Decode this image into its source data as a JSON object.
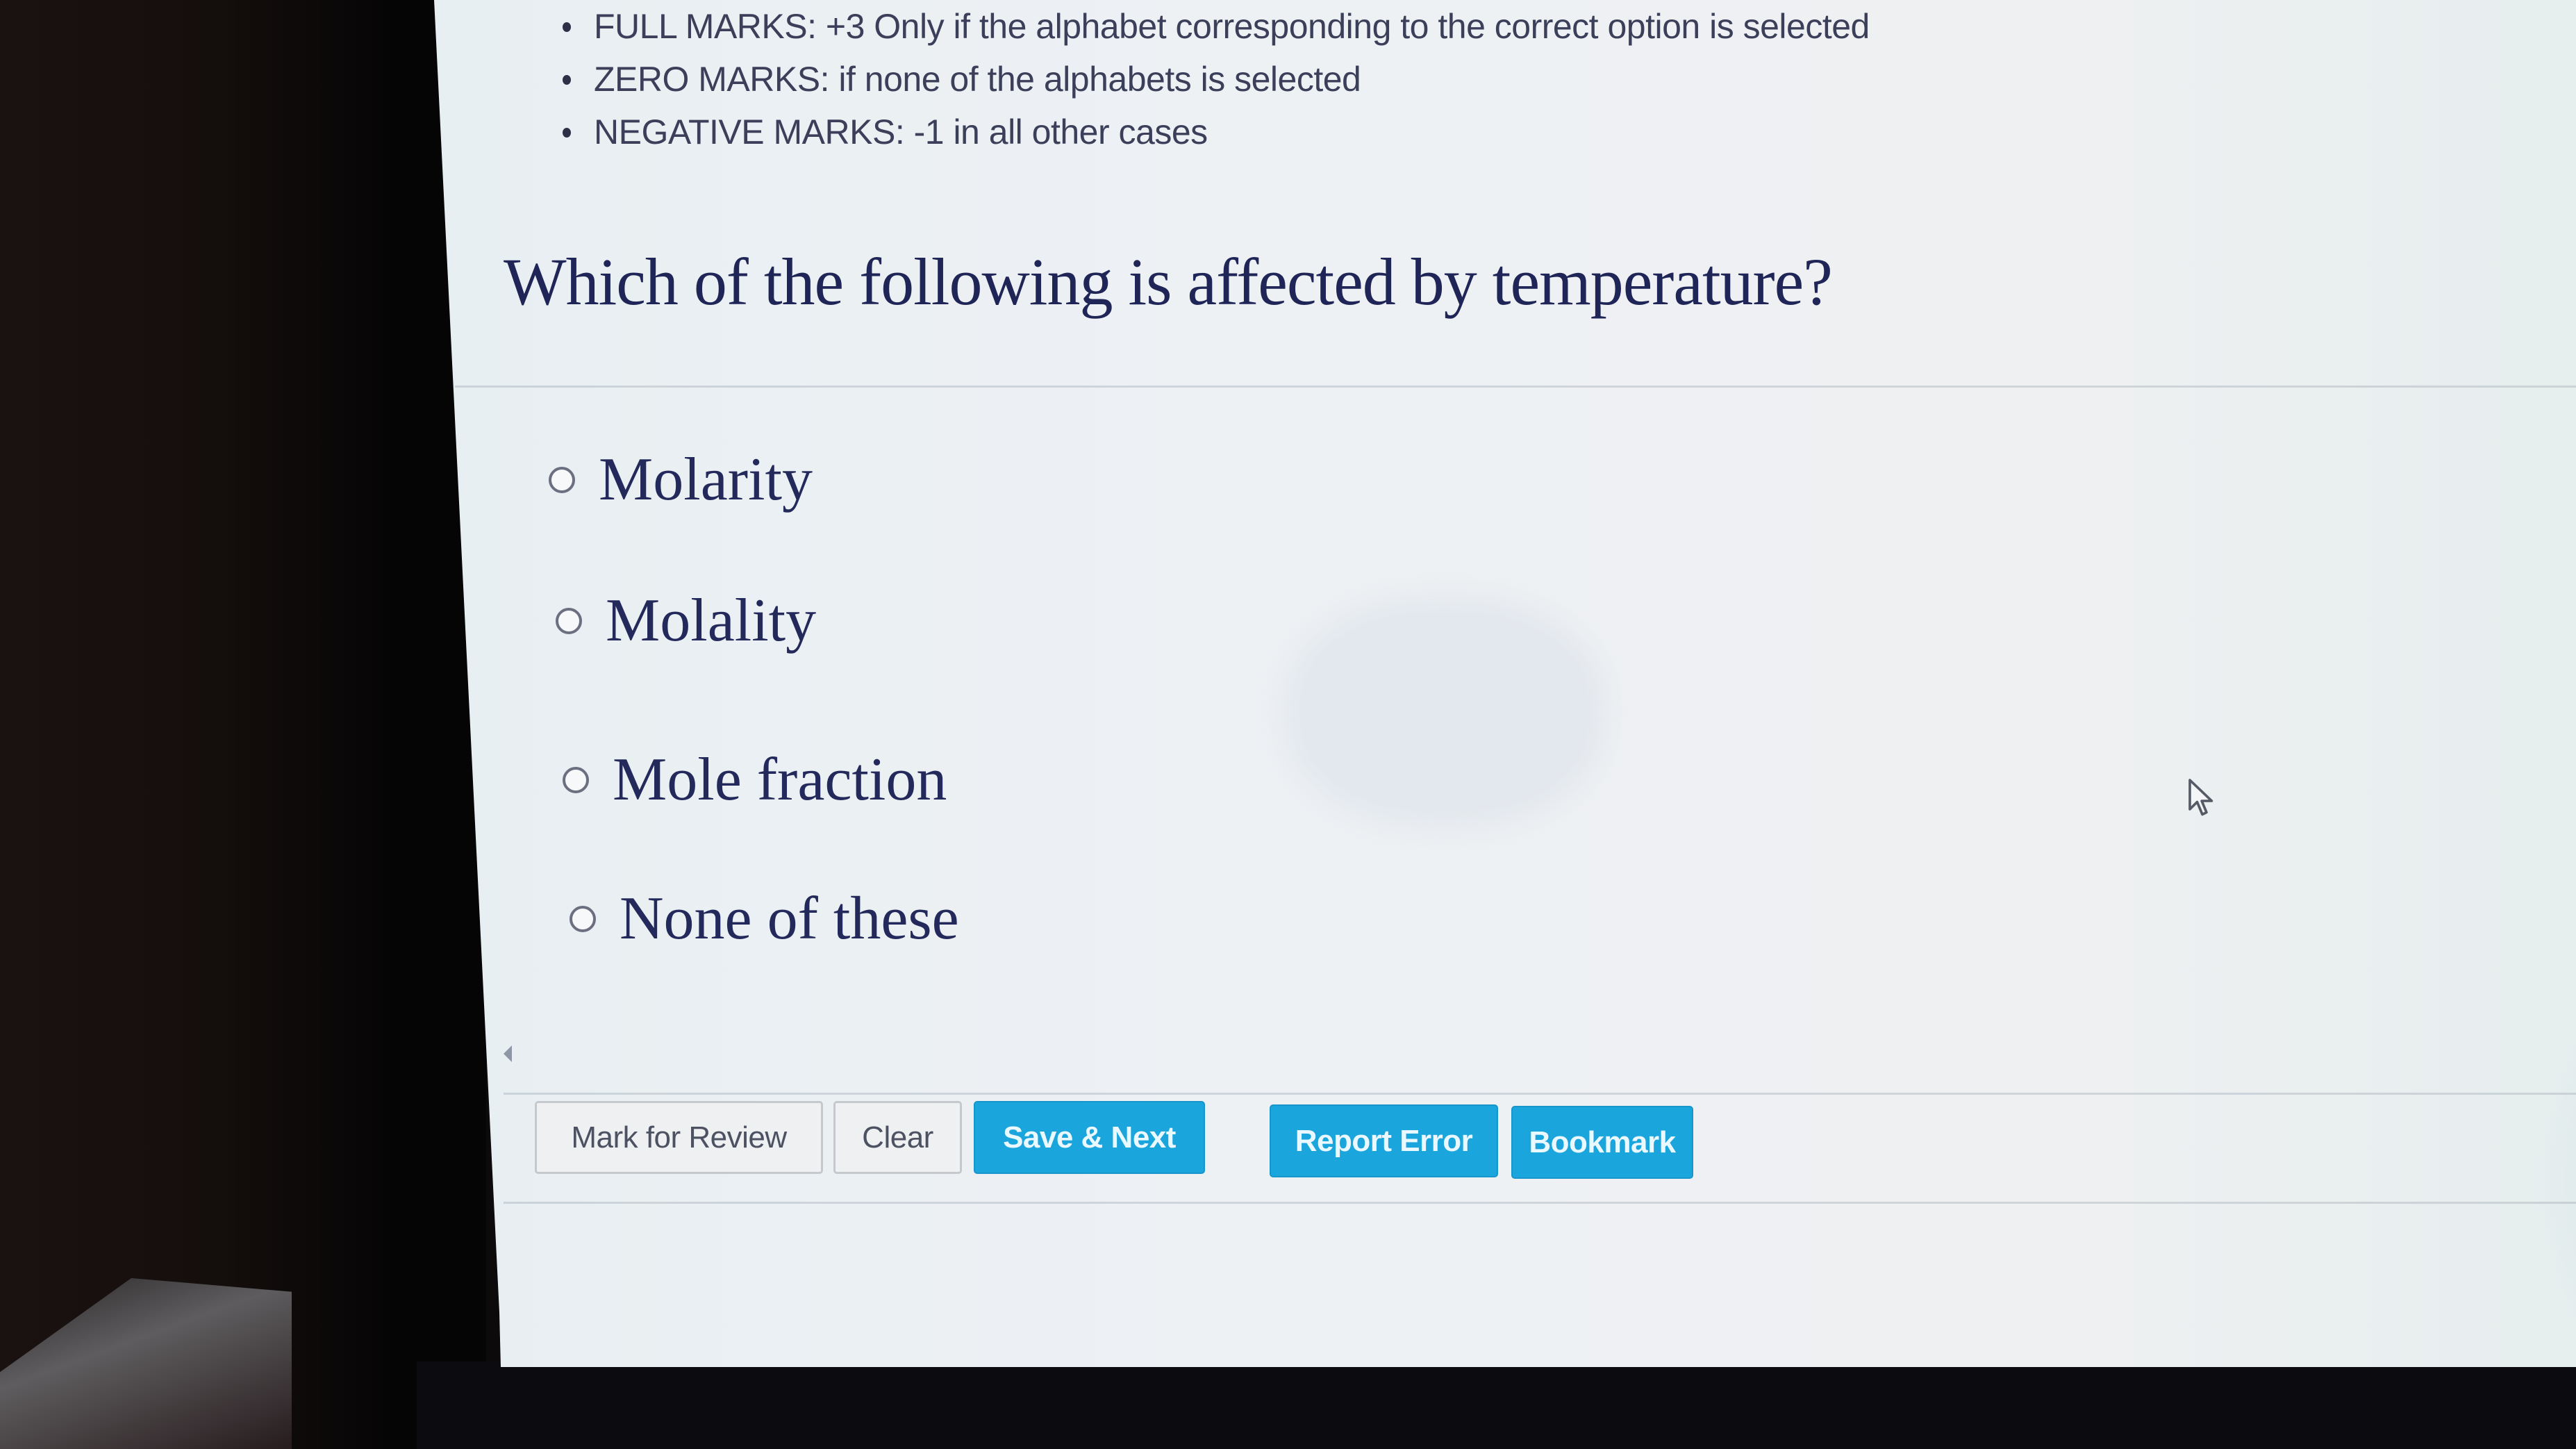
{
  "marking_scheme": [
    "FULL MARKS: +3 Only if the alphabet corresponding to the correct option is selected",
    "ZERO MARKS: if none of the alphabets is selected",
    "NEGATIVE MARKS: -1 in all other cases"
  ],
  "question": {
    "text": "Which of the following is affected by temperature?",
    "options": [
      {
        "label": "Molarity",
        "selected": false
      },
      {
        "label": "Molality",
        "selected": false
      },
      {
        "label": "Mole fraction",
        "selected": false
      },
      {
        "label": "None of these",
        "selected": false
      }
    ]
  },
  "actions": {
    "mark_for_review": "Mark for Review",
    "clear": "Clear",
    "save_next": "Save & Next",
    "report_error": "Report Error",
    "bookmark": "Bookmark"
  },
  "icons": {
    "bullet": "bullet-dot",
    "radio": "radio-unchecked",
    "back": "left-triangle",
    "cursor": "mouse-pointer-arrow"
  },
  "colors": {
    "primary_button": "#1ba5dd",
    "question_text": "#1f2556",
    "plain_button_border": "#c5c9ce"
  }
}
